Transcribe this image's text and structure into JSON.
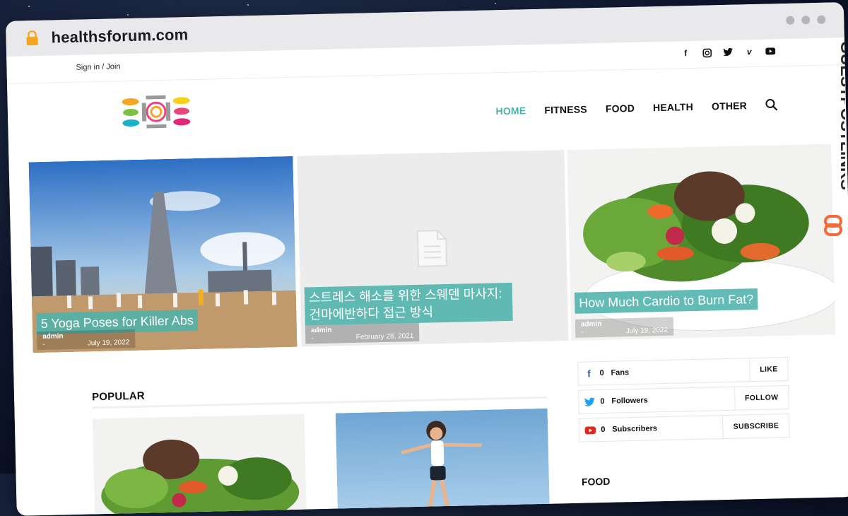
{
  "browser": {
    "url": "healthsforum.com"
  },
  "topbar": {
    "signin": "Sign in / Join",
    "socials": [
      {
        "icon": "facebook-icon",
        "glyph": "f"
      },
      {
        "icon": "instagram-icon",
        "glyph": "◎"
      },
      {
        "icon": "twitter-icon",
        "glyph": "🐦"
      },
      {
        "icon": "vimeo-icon",
        "glyph": "v"
      },
      {
        "icon": "youtube-icon",
        "glyph": "▶"
      }
    ]
  },
  "nav": {
    "items": [
      "HOME",
      "FITNESS",
      "FOOD",
      "HEALTH",
      "OTHER"
    ],
    "active": "HOME",
    "accent": "#4db2ab"
  },
  "hero": [
    {
      "title": "5 Yoga Poses for Killer Abs",
      "author": "admin",
      "sep": "-",
      "date": "July 19, 2022"
    },
    {
      "title": "스트레스 해소를 위한 스웨덴 마사지: 건마에반하다 접근 방식",
      "author": "admin",
      "sep": "-",
      "date": "February 28, 2021"
    },
    {
      "title": "How Much Cardio to Burn Fat?",
      "author": "admin",
      "sep": "-",
      "date": "July 19, 2022"
    }
  ],
  "popular": {
    "title": "POPULAR"
  },
  "sidebar": {
    "social": [
      {
        "icon": "facebook-icon",
        "count": "0",
        "label": "Fans",
        "action": "LIKE",
        "color": "#3b5998"
      },
      {
        "icon": "twitter-icon",
        "count": "0",
        "label": "Followers",
        "action": "FOLLOW",
        "color": "#1da1f2"
      },
      {
        "icon": "youtube-icon",
        "count": "0",
        "label": "Subscribers",
        "action": "SUBSCRIBE",
        "color": "#e02a20"
      }
    ],
    "food_title": "FOOD"
  },
  "watermark": "GUESTPOSTLINKS",
  "colors": {
    "accent": "#4db2ab",
    "watermark": "#f26b3a"
  }
}
